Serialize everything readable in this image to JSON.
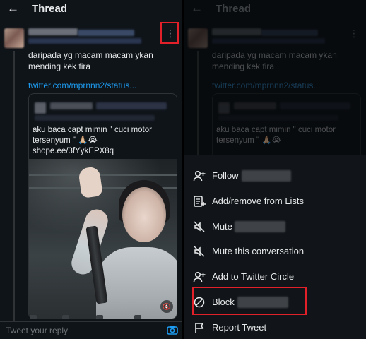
{
  "left_panel": {
    "header": {
      "title": "Thread",
      "back_icon": "arrow-left-icon"
    },
    "tweet": {
      "text_line_1": "daripada yg macam macam ykan",
      "text_line_2": "mending kek fira",
      "link": "twitter.com/mprnnn2/status...",
      "quote": {
        "text_line_1": "aku baca capt mimin \" cuci motor",
        "text_line_2": "tersenyum \" 🙏🏼😭",
        "text_line_3": "shope.ee/3fYykEPX8q"
      }
    },
    "reply_bar": {
      "placeholder": "Tweet your reply"
    }
  },
  "right_panel": {
    "header": {
      "title": "Thread"
    },
    "tweet": {
      "text_line_1": "daripada yg macam macam ykan",
      "text_line_2": "mending kek fira",
      "link": "twitter.com/mprnnn2/status...",
      "quote_line_1": "aku baca capt mimin \" cuci motor",
      "quote_line_2": "tersenyum \" 🙏🏼😭"
    },
    "menu": {
      "follow": "Follow",
      "add_remove_lists": "Add/remove from Lists",
      "mute": "Mute",
      "mute_conversation": "Mute this conversation",
      "add_circle": "Add to Twitter Circle",
      "block": "Block",
      "report": "Report Tweet"
    }
  },
  "colors": {
    "background": "#0f1419",
    "text": "#e7e9ea",
    "link": "#1d9bf0",
    "highlight": "#e1202a",
    "muted": "#71767b"
  }
}
